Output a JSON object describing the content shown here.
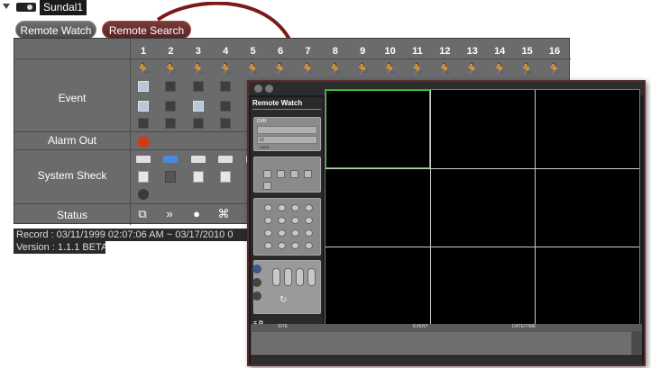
{
  "titlebar": {
    "device_name": "Sundal1"
  },
  "tabs": {
    "remote_watch": "Remote Watch",
    "remote_search": "Remote Search"
  },
  "channels": [
    "1",
    "2",
    "3",
    "4",
    "5",
    "6",
    "7",
    "8",
    "9",
    "10",
    "11",
    "12",
    "13",
    "14",
    "15",
    "16"
  ],
  "rows": {
    "event": "Event",
    "alarm_out": "Alarm Out",
    "system_sheck": "System Sheck",
    "status": "Status"
  },
  "info": {
    "record": "Record  : 03/11/1999  02:07:06 AM ~ 03/17/2010  0",
    "version": "Version : 1.1.1 BETA"
  },
  "remote_window": {
    "title": "Remote Watch",
    "box1_line1": "DVR",
    "box1_line2": "ID",
    "box1_line3": "SAVE",
    "log_columns": [
      "SITE",
      "EVENT",
      "DATE/TIME"
    ]
  },
  "colors": {
    "panel_bg": "#6b6b6b",
    "active_event": "#d9a030",
    "selected_cell": "#40d040",
    "search_tab": "#7a3a3a",
    "arrow": "#7a1a1a"
  }
}
